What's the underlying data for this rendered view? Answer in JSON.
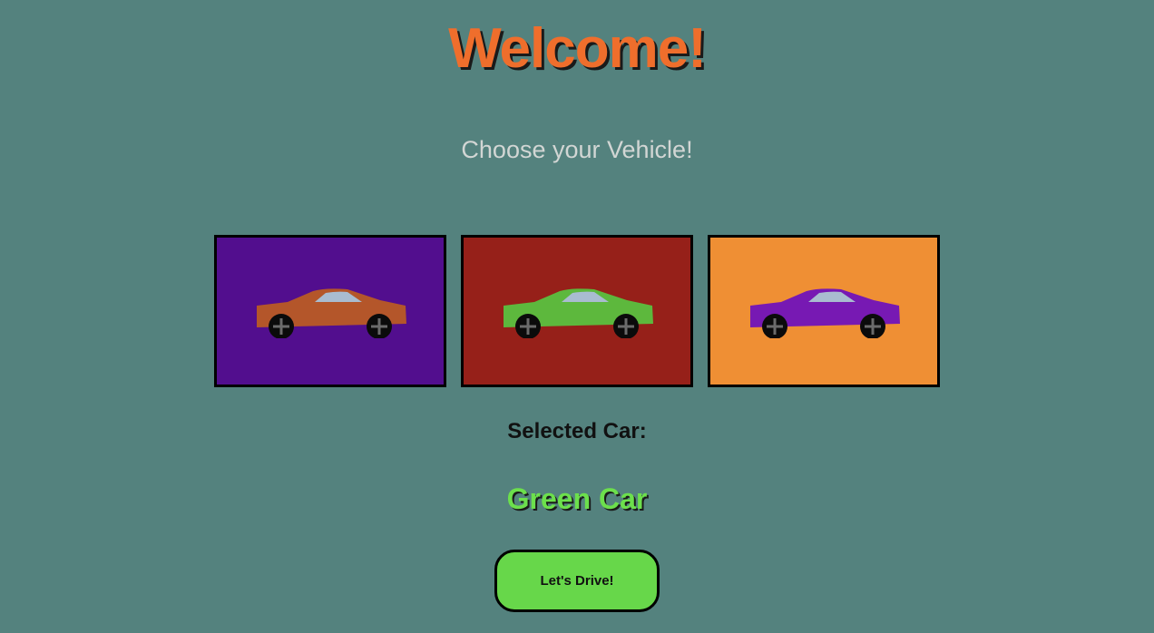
{
  "header": {
    "title": "Welcome!",
    "subtitle": "Choose your Vehicle!"
  },
  "cars": [
    {
      "name": "orange-car",
      "car_color": "#b4562a",
      "background": "#520e8e",
      "icon": "car-icon"
    },
    {
      "name": "green-car",
      "car_color": "#5db83d",
      "background": "#962019",
      "icon": "car-icon"
    },
    {
      "name": "purple-car",
      "car_color": "#7719b3",
      "background": "#ef8f34",
      "icon": "car-icon"
    }
  ],
  "selection": {
    "label": "Selected Car:",
    "value": "Green Car"
  },
  "actions": {
    "drive_label": "Let's Drive!"
  },
  "colors": {
    "page_background": "#54827e",
    "title": "#ef6e2c",
    "selected_value": "#6ce04c",
    "button": "#67d74a"
  }
}
